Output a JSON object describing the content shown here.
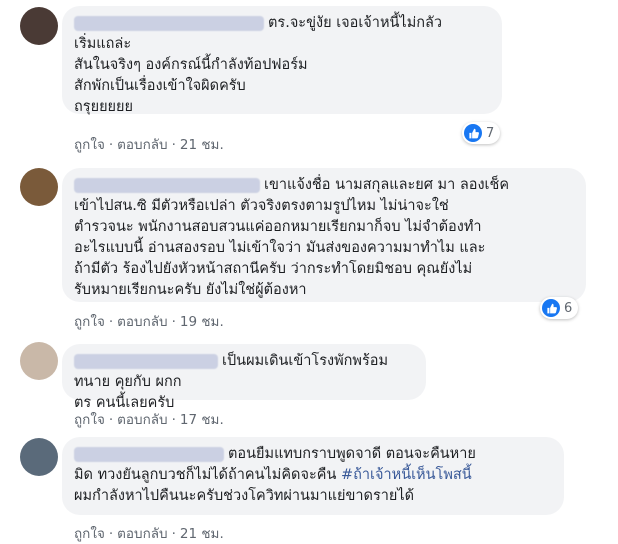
{
  "comments": [
    {
      "avatar_color": "#4a3a35",
      "text": "ตร.จะขู่งัย เจอเจ้าหนี้ไม่กลัว\nเริ่มแถล่ะ\nสันในจริงๆ องค์กรณ์นี้กำลังท้อปฟอร์ม\nสักพักเป็นเรื่องเข้าใจผิดครับ\nถรุยยยยย",
      "like_label": "ถูกใจ",
      "reply_label": "ตอบกลับ",
      "time": "21 ชม.",
      "reaction_count": "7"
    },
    {
      "avatar_color": "#7a5a3a",
      "text": "เขาแจ้งชื่อ นามสกุลและยศ มา ลองเช็ค\nเข้าไปสน.ซิ มีตัวหรือเปล่า ตัวจริงตรงตามรูปไหม ไม่น่าจะใช่\nตำรวจนะ พนักงานสอบสวนแค่ออกหมายเรียกมาก็จบ ไม่จำต้องทำ\nอะไรแบบนี้ อ่านสองรอบ ไม่เข้าใจว่า มันส่งของความมาทำไม และ\nถ้ามีตัว ร้องไปยังหัวหน้าสถานีครับ ว่ากระทำโดยมิชอบ คุณยังไม่\nรับหมายเรียกนะครับ ยังไม่ใช่ผู้ต้องหา",
      "like_label": "ถูกใจ",
      "reply_label": "ตอบกลับ",
      "time": "19 ชม.",
      "reaction_count": "6"
    },
    {
      "avatar_color": "#c9b8a8",
      "text": "เป็นผมเดินเข้าโรงพักพร้อมทนาย คุยกับ ผกก\nตร คนนี้เลยครับ",
      "like_label": "ถูกใจ",
      "reply_label": "ตอบกลับ",
      "time": "17 ชม."
    },
    {
      "avatar_color": "#5a6a7a",
      "text_before": "ตอนยืมแทบกราบพูดจาดี ตอนจะคืนหาย\nมิด ทวงยันลูกบวชก็ไม่ได้ถ้าคนไม่คิดจะคืน ",
      "hashtag": "#ถ้าเจ้าหนี้เห็นโพสนี้",
      "text_after": "\nผมกำลังหาไปคืนนะครับช่วงโควิทผ่านมาแย่ขาดรายได้",
      "like_label": "ถูกใจ",
      "reply_label": "ตอบกลับ",
      "time": "21 ชม."
    }
  ],
  "separator": "·",
  "colors": {
    "bubble": "#f2f3f5",
    "action": "#606770",
    "link": "#385898",
    "like": "#1877f2"
  }
}
